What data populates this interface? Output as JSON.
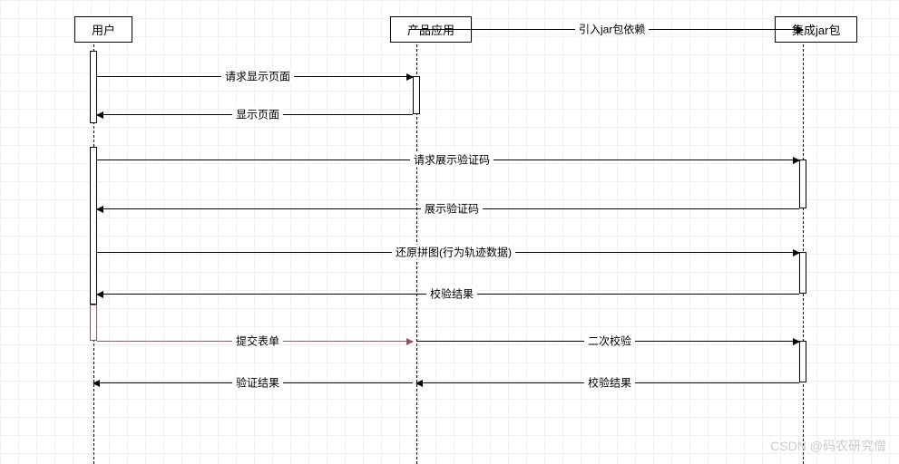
{
  "participants": {
    "user": "用户",
    "app": "产品应用",
    "jar": "集成jar包"
  },
  "messages": {
    "m0": "引入jar包依赖",
    "m1": "请求显示页面",
    "m2": "显示页面",
    "m3": "请求展示验证码",
    "m4": "展示验证码",
    "m5": "还原拼图(行为轨迹数据)",
    "m6": "校验结果",
    "m7": "提交表单",
    "m8": "二次校验",
    "m9": "验证结果",
    "m10": "校验结果"
  },
  "watermark": "CSDN @码农研究僧",
  "chart_data": {
    "type": "sequence_diagram",
    "participants": [
      "用户",
      "产品应用",
      "集成jar包"
    ],
    "messages": [
      {
        "from": "产品应用",
        "to": "集成jar包",
        "label": "引入jar包依赖",
        "direction": "right"
      },
      {
        "from": "用户",
        "to": "产品应用",
        "label": "请求显示页面",
        "direction": "right"
      },
      {
        "from": "产品应用",
        "to": "用户",
        "label": "显示页面",
        "direction": "left"
      },
      {
        "from": "用户",
        "to": "集成jar包",
        "label": "请求展示验证码",
        "direction": "right"
      },
      {
        "from": "集成jar包",
        "to": "用户",
        "label": "展示验证码",
        "direction": "left"
      },
      {
        "from": "用户",
        "to": "集成jar包",
        "label": "还原拼图(行为轨迹数据)",
        "direction": "right"
      },
      {
        "from": "集成jar包",
        "to": "用户",
        "label": "校验结果",
        "direction": "left"
      },
      {
        "from": "用户",
        "to": "产品应用",
        "label": "提交表单",
        "direction": "right",
        "style": "reddish"
      },
      {
        "from": "产品应用",
        "to": "集成jar包",
        "label": "二次校验",
        "direction": "right"
      },
      {
        "from": "产品应用",
        "to": "用户",
        "label": "验证结果",
        "direction": "left"
      },
      {
        "from": "集成jar包",
        "to": "产品应用",
        "label": "校验结果",
        "direction": "left"
      }
    ]
  }
}
